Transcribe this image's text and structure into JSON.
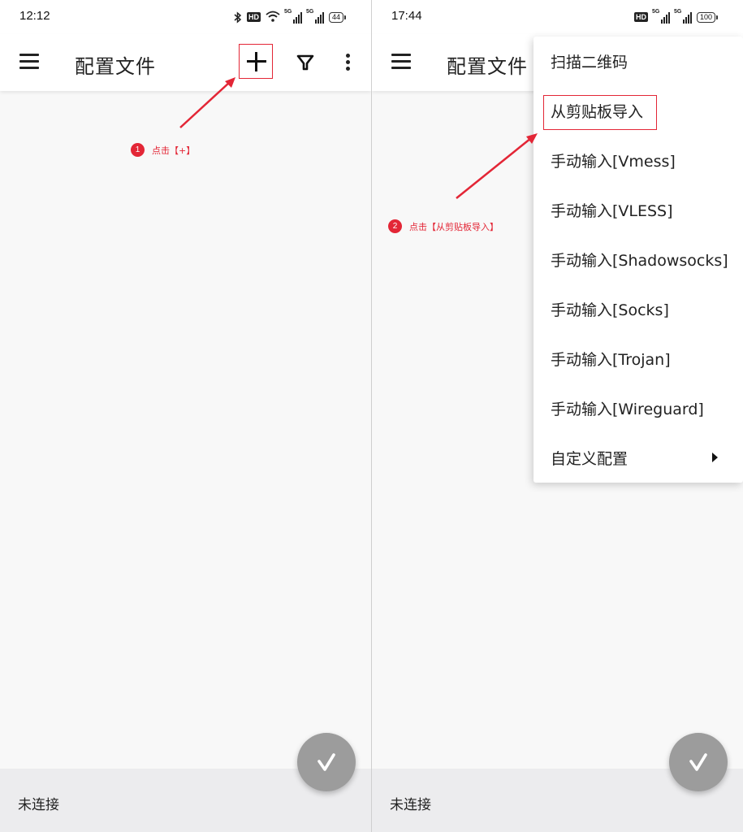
{
  "left": {
    "status": {
      "time": "12:12",
      "hd": "HD",
      "sim1": "5G",
      "sim2": "5G",
      "battery": "44"
    },
    "appbar": {
      "title": "配置文件"
    },
    "annotation": {
      "step": "1",
      "text": "点击【+】"
    },
    "bottom": {
      "connection_status": "未连接"
    }
  },
  "right": {
    "status": {
      "time": "17:44",
      "hd": "HD",
      "sim1": "5G",
      "sim2": "5G",
      "battery": "100"
    },
    "appbar": {
      "title": "配置文件"
    },
    "menu": {
      "items": [
        "扫描二维码",
        "从剪贴板导入",
        "手动输入[Vmess]",
        "手动输入[VLESS]",
        "手动输入[Shadowsocks]",
        "手动输入[Socks]",
        "手动输入[Trojan]",
        "手动输入[Wireguard]",
        "自定义配置"
      ]
    },
    "annotation": {
      "step": "2",
      "text": "点击【从剪贴板导入】"
    },
    "bottom": {
      "connection_status": "未连接"
    }
  },
  "colors": {
    "annotation_red": "#e32636",
    "fab": "#9c9c9c",
    "bottom_bar": "#ececee"
  },
  "icons": [
    "menu-icon",
    "add-icon",
    "filter-icon",
    "more-vert-icon",
    "v-logo-icon",
    "bluetooth-icon",
    "wifi-icon",
    "signal-icon",
    "battery-icon",
    "chevron-right-icon"
  ]
}
